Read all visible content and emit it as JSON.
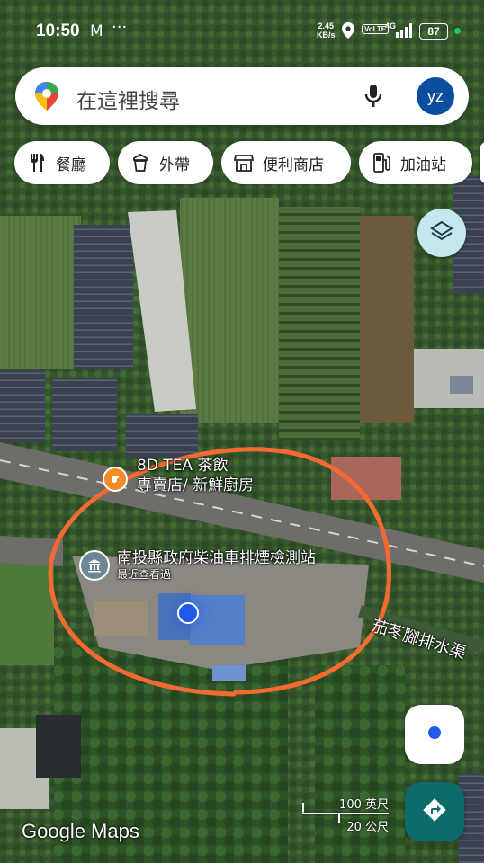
{
  "status_bar": {
    "time": "10:50",
    "net_speed_value": "2.45",
    "net_speed_unit": "KB/s",
    "volte": "VoLTE",
    "network": "4G",
    "battery": "87"
  },
  "search": {
    "placeholder": "在這裡搜尋",
    "avatar_initials": "yz"
  },
  "chips": [
    {
      "label": "餐廳",
      "icon": "fork-knife-icon"
    },
    {
      "label": "外帶",
      "icon": "takeout-icon"
    },
    {
      "label": "便利商店",
      "icon": "store-icon"
    },
    {
      "label": "加油站",
      "icon": "gas-station-icon"
    }
  ],
  "map": {
    "poi_cafe": {
      "line1": "8D TEA 茶飲",
      "line2": "專賣店/ 新鮮廚房",
      "icon": "cafe-icon",
      "color": "#f28c28"
    },
    "poi_station": {
      "name": "南投縣政府柴油車排煙檢測站",
      "sub": "最近查看過",
      "icon": "government-building-icon"
    },
    "water_label": "茄苳腳排水渠",
    "annotation_color": "#f46a32",
    "location_dot_color": "#1f5be8"
  },
  "scale": {
    "imperial": "100 英尺",
    "metric": "20 公尺"
  },
  "branding": {
    "logo": "Google Maps"
  }
}
